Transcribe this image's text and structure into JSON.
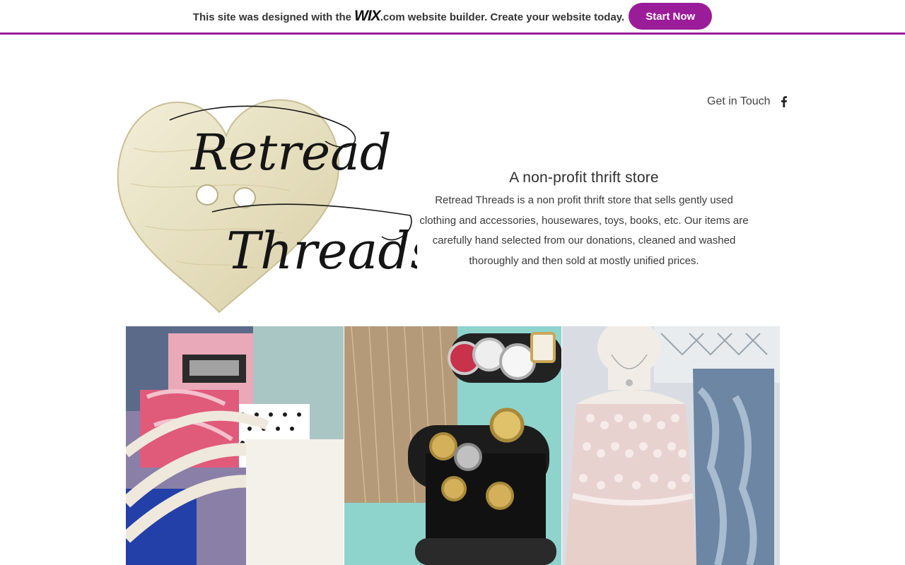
{
  "banner": {
    "text_before": "This site was designed with the",
    "logo_text": "WIX",
    "logo_suffix": ".com",
    "text_after": "website builder. Create your website today.",
    "cta_label": "Start Now",
    "accent_color": "#9b1c98"
  },
  "header": {
    "contact_link": "Get in Touch",
    "social_icon": "facebook-icon"
  },
  "logo": {
    "line1": "Retread",
    "line2": "Threads"
  },
  "intro": {
    "title": "A non-profit thrift store",
    "body": "Retread Threads is a non profit thrift store that sells gently used clothing and accessories, housewares, toys, books, etc. Our items are carefully hand selected from our donations, cleaned and washed thoroughly and then sold at mostly unified prices."
  },
  "gallery": {
    "items": [
      {
        "subject": "clothing-on-hangers"
      },
      {
        "subject": "watch-display"
      },
      {
        "subject": "mannequin-dress-and-jeans"
      }
    ]
  }
}
